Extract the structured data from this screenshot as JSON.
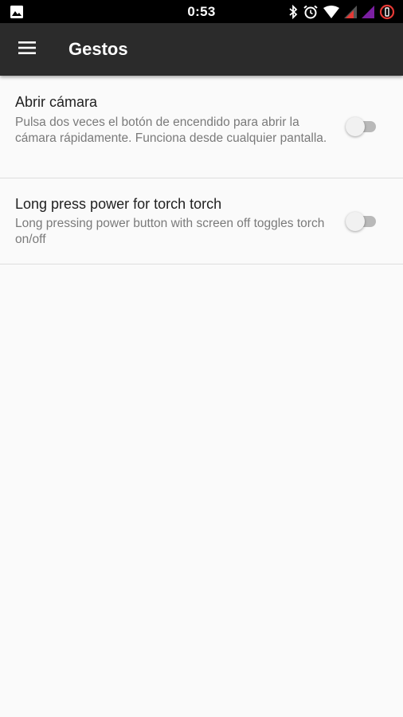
{
  "status_bar": {
    "time": "0:53",
    "left_icon": "image-notification-icon",
    "right_icons": [
      "bluetooth-icon",
      "alarm-icon",
      "wifi-icon",
      "signal-icon",
      "signal-icon",
      "battery-saver-icon"
    ],
    "colors": {
      "background": "#000000",
      "signal1": "#e53935",
      "signal2": "#7b1fa2",
      "battery": "#e53935"
    }
  },
  "app_bar": {
    "title": "Gestos",
    "menu_icon": "hamburger-menu-icon",
    "background": "#2b2b2b"
  },
  "preferences": [
    {
      "title": "Abrir cámara",
      "summary": "Pulsa dos veces el botón de encendido para abrir la cámara rápidamente. Funciona desde cualquier pantalla.",
      "enabled": false
    },
    {
      "title": "Long press power for torch torch",
      "summary": "Long pressing power button with screen off toggles torch on/off",
      "enabled": false
    }
  ]
}
